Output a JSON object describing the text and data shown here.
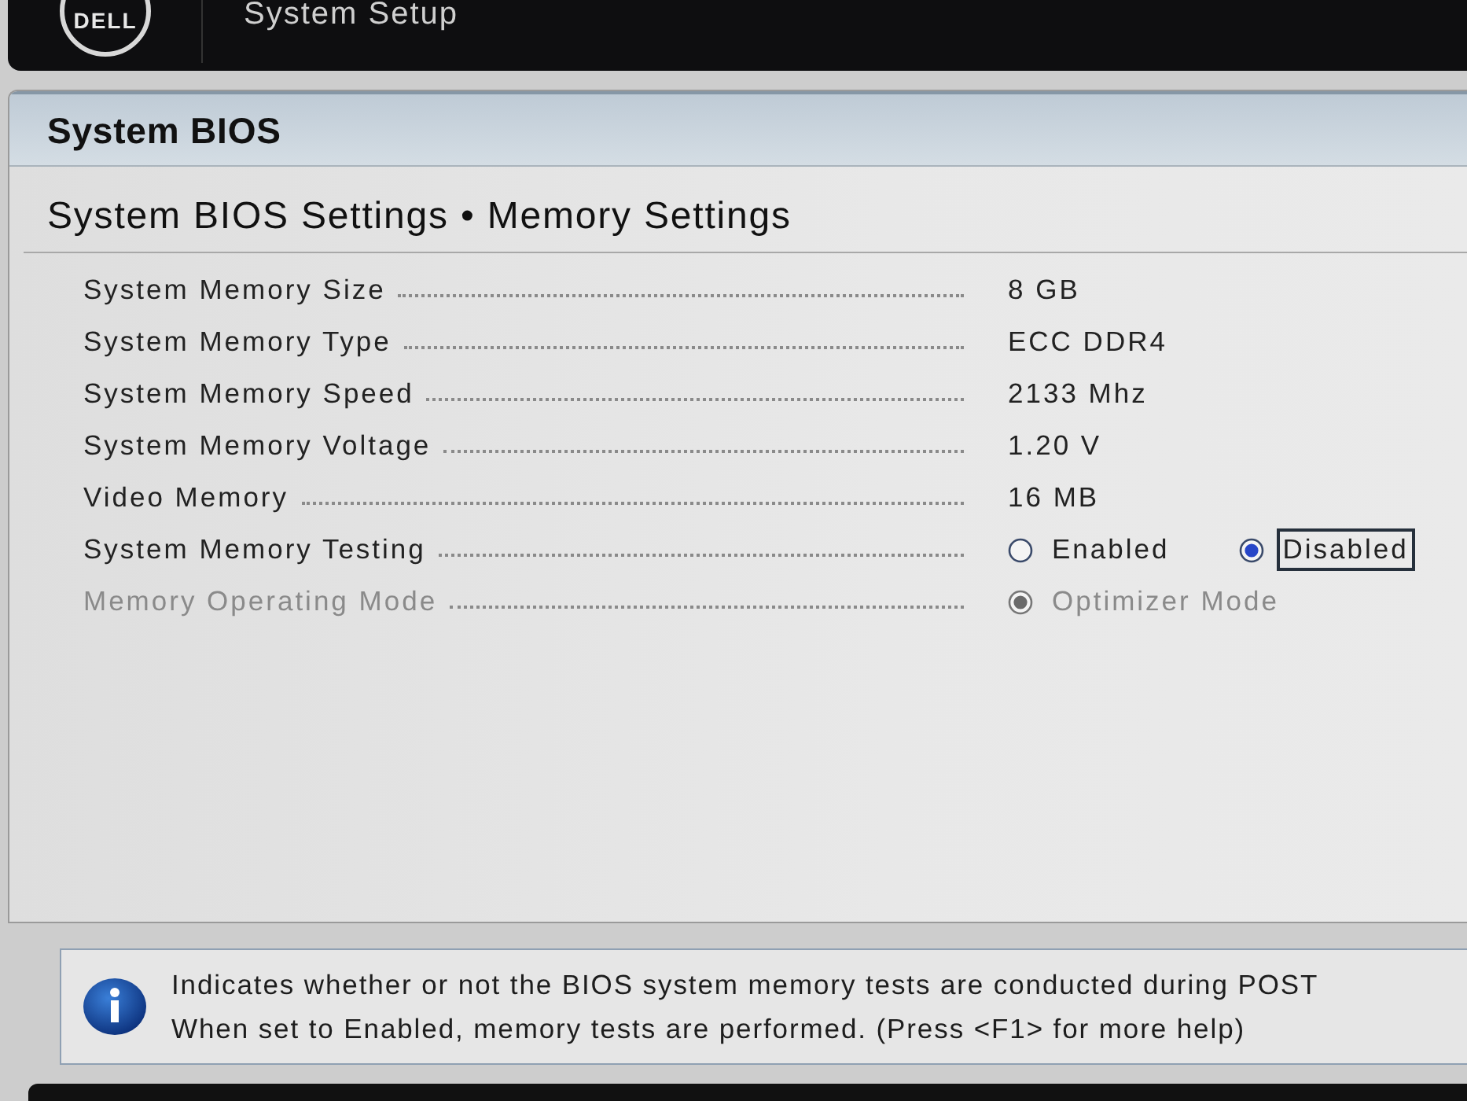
{
  "header": {
    "logo": "DELL",
    "title": "System Setup"
  },
  "page": {
    "title": "System BIOS",
    "breadcrumb": "System BIOS Settings • Memory Settings"
  },
  "settings": [
    {
      "kind": "value",
      "label": "System Memory Size",
      "value": "8 GB",
      "disabled": false
    },
    {
      "kind": "value",
      "label": "System Memory Type",
      "value": "ECC DDR4",
      "disabled": false
    },
    {
      "kind": "value",
      "label": "System Memory Speed",
      "value": "2133 Mhz",
      "disabled": false
    },
    {
      "kind": "value",
      "label": "System Memory Voltage",
      "value": "1.20 V",
      "disabled": false
    },
    {
      "kind": "value",
      "label": "Video Memory",
      "value": "16 MB",
      "disabled": false
    },
    {
      "kind": "radio",
      "label": "System Memory Testing",
      "disabled": false,
      "options": [
        {
          "label": "Enabled",
          "selected": false,
          "focused": false
        },
        {
          "label": "Disabled",
          "selected": true,
          "focused": true
        }
      ]
    },
    {
      "kind": "radio",
      "label": "Memory Operating Mode",
      "disabled": true,
      "options": [
        {
          "label": "Optimizer Mode",
          "selected": true,
          "focused": false
        }
      ]
    }
  ],
  "help": {
    "lines": [
      "Indicates whether or not the BIOS system memory tests are conducted during POST",
      "When set to Enabled, memory tests are performed. (Press <F1> for more help)"
    ]
  }
}
